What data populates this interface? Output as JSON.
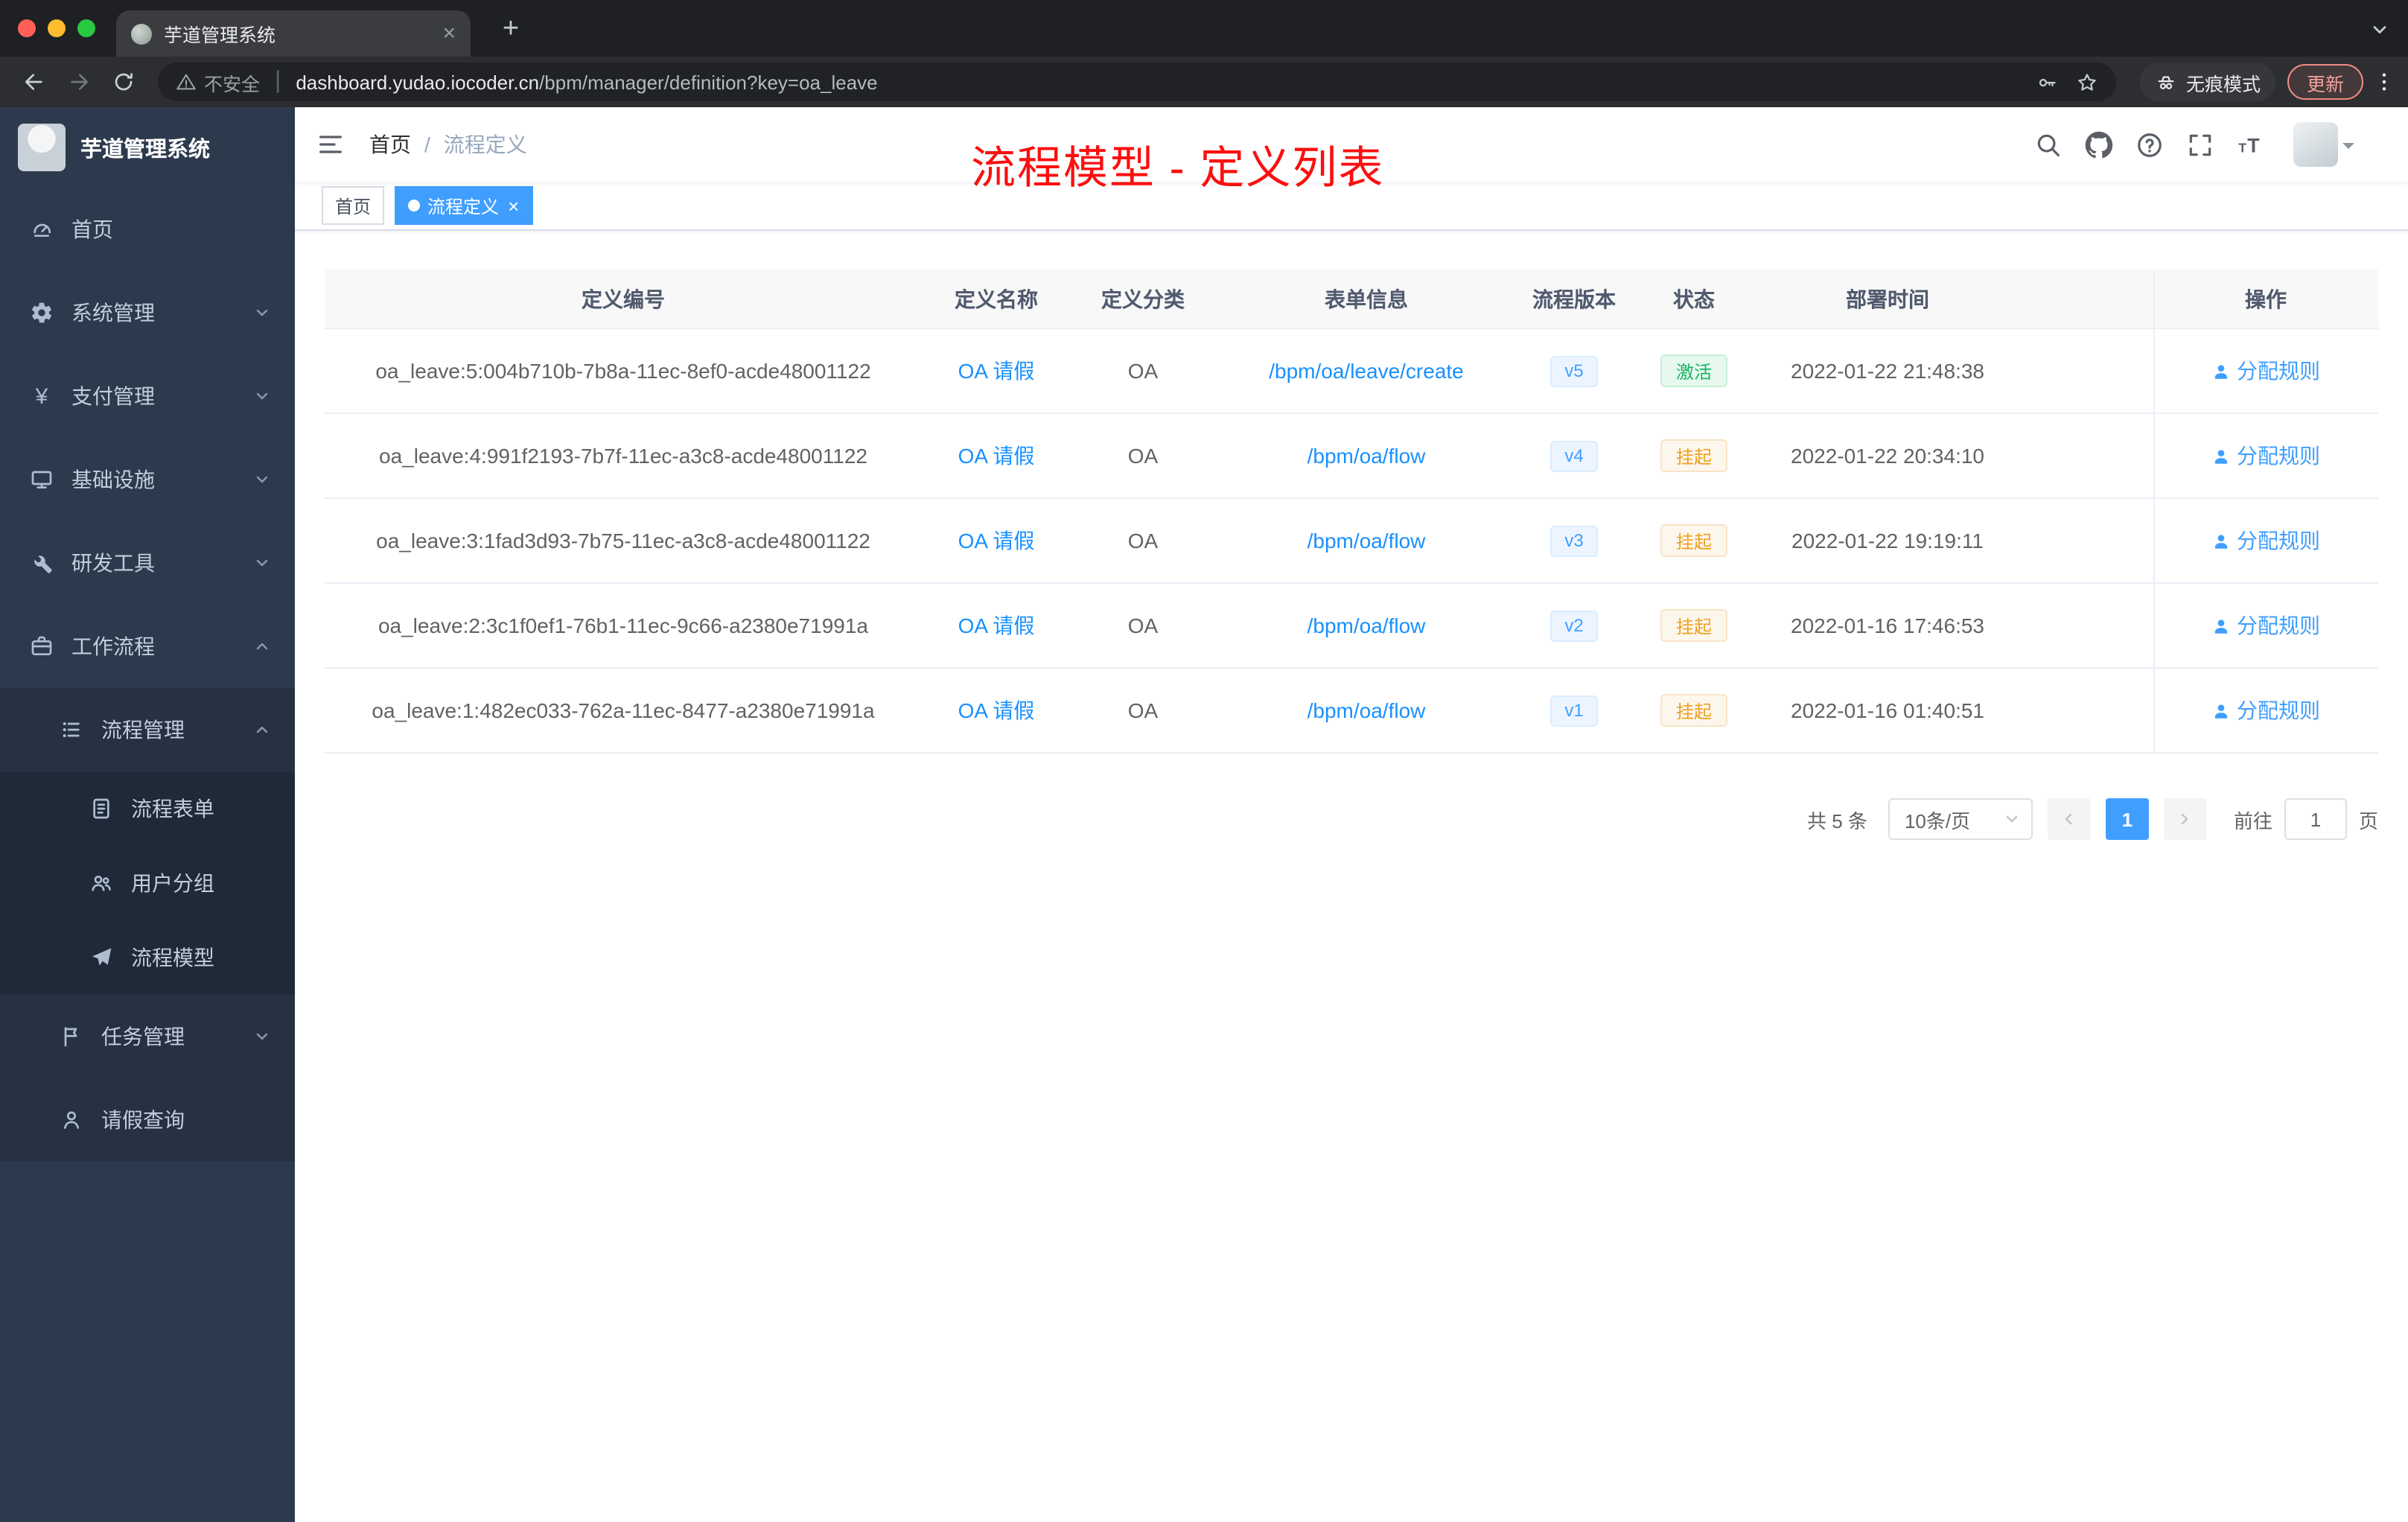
{
  "browser": {
    "tab_title": "芋道管理系统",
    "tab_close_glyph": "×",
    "new_tab_glyph": "+",
    "security_label": "不安全",
    "url_host": "dashboard.yudao.iocoder.cn",
    "url_path": "/bpm/manager/definition?key=oa_leave",
    "incognito_label": "无痕模式",
    "update_label": "更新"
  },
  "sidebar": {
    "app_title": "芋道管理系统",
    "items": [
      {
        "label": "首页"
      },
      {
        "label": "系统管理"
      },
      {
        "label": "支付管理"
      },
      {
        "label": "基础设施"
      },
      {
        "label": "研发工具"
      },
      {
        "label": "工作流程"
      },
      {
        "label": "流程管理"
      },
      {
        "label": "流程表单"
      },
      {
        "label": "用户分组"
      },
      {
        "label": "流程模型"
      },
      {
        "label": "任务管理"
      },
      {
        "label": "请假查询"
      }
    ]
  },
  "navbar": {
    "breadcrumb_home": "首页",
    "breadcrumb_sep": "/",
    "breadcrumb_current": "流程定义",
    "annotation": "流程模型 - 定义列表"
  },
  "tags": {
    "home": "首页",
    "active": "流程定义",
    "close_glyph": "×"
  },
  "table": {
    "columns": [
      "定义编号",
      "定义名称",
      "定义分类",
      "表单信息",
      "流程版本",
      "状态",
      "部署时间",
      "操作"
    ],
    "rows": [
      {
        "id": "oa_leave:5:004b710b-7b8a-11ec-8ef0-acde48001122",
        "name": "OA 请假",
        "category": "OA",
        "form": "/bpm/oa/leave/create",
        "version": "v5",
        "status": "激活",
        "time": "2022-01-22 21:48:38",
        "action": "分配规则"
      },
      {
        "id": "oa_leave:4:991f2193-7b7f-11ec-a3c8-acde48001122",
        "name": "OA 请假",
        "category": "OA",
        "form": "/bpm/oa/flow",
        "version": "v4",
        "status": "挂起",
        "time": "2022-01-22 20:34:10",
        "action": "分配规则"
      },
      {
        "id": "oa_leave:3:1fad3d93-7b75-11ec-a3c8-acde48001122",
        "name": "OA 请假",
        "category": "OA",
        "form": "/bpm/oa/flow",
        "version": "v3",
        "status": "挂起",
        "time": "2022-01-22 19:19:11",
        "action": "分配规则"
      },
      {
        "id": "oa_leave:2:3c1f0ef1-76b1-11ec-9c66-a2380e71991a",
        "name": "OA 请假",
        "category": "OA",
        "form": "/bpm/oa/flow",
        "version": "v2",
        "status": "挂起",
        "time": "2022-01-16 17:46:53",
        "action": "分配规则"
      },
      {
        "id": "oa_leave:1:482ec033-762a-11ec-8477-a2380e71991a",
        "name": "OA 请假",
        "category": "OA",
        "form": "/bpm/oa/flow",
        "version": "v1",
        "status": "挂起",
        "time": "2022-01-16 01:40:51",
        "action": "分配规则"
      }
    ]
  },
  "pagination": {
    "total": "共 5 条",
    "page_size": "10条/页",
    "page": "1",
    "goto_label": "前往",
    "goto_value": "1",
    "unit_label": "页"
  },
  "colors": {
    "accent": "#409eff",
    "link": "#1890ff",
    "success": "#18b566",
    "warning": "#f0a020",
    "annotation": "#fb0f0f",
    "sidebar_bg": "#2d3a4e"
  }
}
